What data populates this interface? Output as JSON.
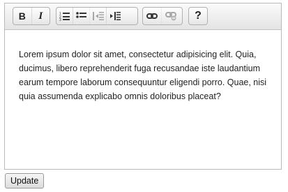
{
  "toolbar": {
    "groups": [
      {
        "buttons": [
          {
            "icon": "bold-icon",
            "glyph": "B"
          },
          {
            "icon": "italic-icon",
            "glyph": "I"
          }
        ]
      },
      {
        "buttons": [
          {
            "icon": "numbered-list-icon"
          },
          {
            "icon": "bulleted-list-icon"
          },
          {
            "icon": "outdent-icon",
            "disabled": true
          },
          {
            "icon": "indent-icon"
          }
        ]
      },
      {
        "buttons": [
          {
            "icon": "link-icon"
          },
          {
            "icon": "unlink-icon",
            "disabled": true
          }
        ]
      },
      {
        "buttons": [
          {
            "icon": "help-icon",
            "glyph": "?"
          }
        ]
      }
    ]
  },
  "editor": {
    "content": "Lorem ipsum dolor sit amet, consectetur adipisicing elit. Quia, ducimus, libero reprehenderit fuga recusandae iste laudantium earum tempore laborum consequuntur eligendi porro. Quae, nisi quia assumenda explicabo omnis doloribus placeat?"
  },
  "actions": {
    "update_label": "Update"
  }
}
